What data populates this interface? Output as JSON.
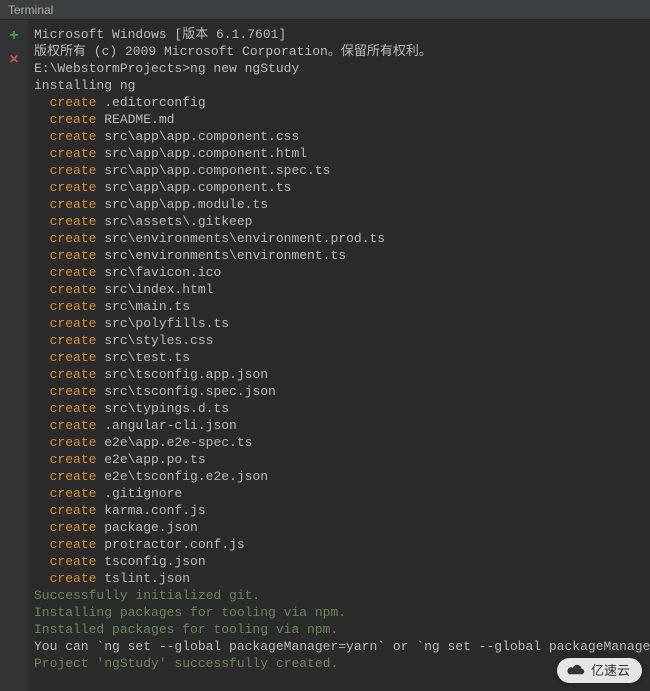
{
  "title": "Terminal",
  "header": {
    "line1": "Microsoft Windows [版本 6.1.7601]",
    "line2": "版权所有 (c) 2009 Microsoft Corporation。保留所有权利。"
  },
  "prompt": "E:\\WebstormProjects>",
  "command": "ng new ngStudy",
  "installing": "installing ng",
  "create_keyword": "create",
  "files": [
    ".editorconfig",
    "README.md",
    "src\\app\\app.component.css",
    "src\\app\\app.component.html",
    "src\\app\\app.component.spec.ts",
    "src\\app\\app.component.ts",
    "src\\app\\app.module.ts",
    "src\\assets\\.gitkeep",
    "src\\environments\\environment.prod.ts",
    "src\\environments\\environment.ts",
    "src\\favicon.ico",
    "src\\index.html",
    "src\\main.ts",
    "src\\polyfills.ts",
    "src\\styles.css",
    "src\\test.ts",
    "src\\tsconfig.app.json",
    "src\\tsconfig.spec.json",
    "src\\typings.d.ts",
    ".angular-cli.json",
    "e2e\\app.e2e-spec.ts",
    "e2e\\app.po.ts",
    "e2e\\tsconfig.e2e.json",
    ".gitignore",
    "karma.conf.js",
    "package.json",
    "protractor.conf.js",
    "tsconfig.json",
    "tslint.json"
  ],
  "footer": {
    "git": "Successfully initialized git.",
    "installing_pkg": "Installing packages for tooling via npm.",
    "installed_pkg": "Installed packages for tooling via npm.",
    "hint": "You can `ng set --global packageManager=yarn` or `ng set --global packageManager=cnpm`.",
    "success": "Project 'ngStudy' successfully created."
  },
  "watermark": "亿速云"
}
